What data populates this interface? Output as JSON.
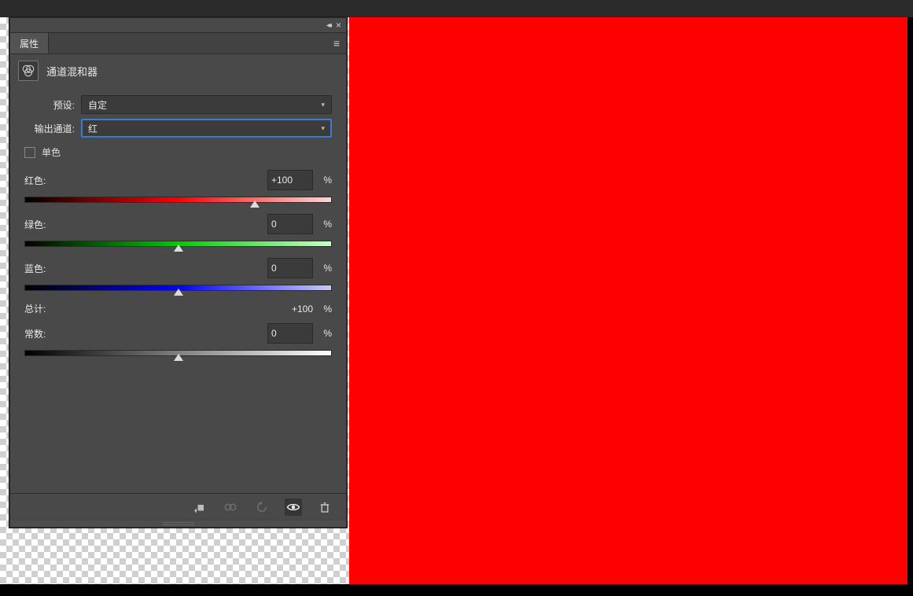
{
  "panel": {
    "tab_label": "属性",
    "adjustment_name": "通道混和器",
    "preset_label": "预设:",
    "preset_value": "自定",
    "output_label": "输出通道:",
    "output_value": "红",
    "mono_label": "单色",
    "sliders": {
      "red": {
        "label": "红色:",
        "value": "+100",
        "unit": "%",
        "pos": 75
      },
      "green": {
        "label": "绿色:",
        "value": "0",
        "unit": "%",
        "pos": 50
      },
      "blue": {
        "label": "蓝色:",
        "value": "0",
        "unit": "%",
        "pos": 50
      },
      "const": {
        "label": "常数:",
        "value": "0",
        "unit": "%",
        "pos": 50
      }
    },
    "total_label": "总计:",
    "total_value": "+100",
    "total_unit": "%"
  },
  "colors": {
    "canvas": "#ff0000"
  }
}
